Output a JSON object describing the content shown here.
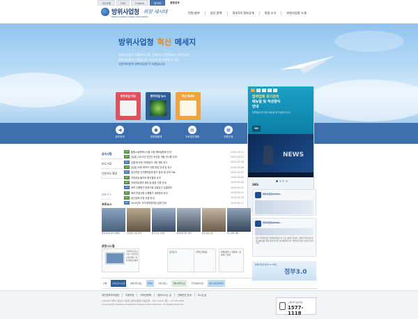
{
  "top_utility": {
    "items": [
      "사이트맵",
      "RSS",
      "English",
      "중국어"
    ],
    "search_label": "통합검색"
  },
  "header": {
    "logo_text": "방위사업청",
    "logo_sub": "Defense Acquisition Program Administration",
    "slogan": "희망 새시대",
    "gnb": [
      "민원·참여",
      "업무·정책",
      "정부3.0 정보공개",
      "알림·소식",
      "방위사업청 소개"
    ]
  },
  "hero": {
    "title_a": "방위사업청",
    "title_b": "혁신",
    "title_c": "메세지",
    "line1": "방위사업청이 투명하고 더욱 강해지고 전문화되어 더욱 높이는",
    "line2": "방위사업청이 되겠습니다. 다시 한 번 신뢰할 수 있는",
    "line3": "국민여러분의 방위사업청 이 되겠습니다.",
    "cards": [
      {
        "label": "방위사업 이슈",
        "color": "#e1515c"
      },
      {
        "label": "방위사업 뉴스",
        "color": "#2d5e9a"
      },
      {
        "label": "혁신 메세지",
        "color": "#f2a43a"
      }
    ]
  },
  "promo": {
    "tabs": [
      "1",
      "2",
      "3",
      "4",
      "5"
    ],
    "title_line1": "협력업체 위기관리",
    "title_line2": "매뉴얼 및 작성양식",
    "title_line3": "안내",
    "text": "협력업체 위기관리 매뉴얼 및 작성양식 안내",
    "go_label": "GO",
    "video_text": "NEWS"
  },
  "quick_menu": [
    {
      "label": "정보공개",
      "icon": "speaker-icon",
      "glyph": "◀"
    },
    {
      "label": "방위청결제",
      "icon": "person-icon",
      "glyph": "●"
    },
    {
      "label": "주요업무계획",
      "icon": "document-icon",
      "glyph": "▤"
    },
    {
      "label": "민원신청",
      "icon": "form-icon",
      "glyph": "▦"
    }
  ],
  "notice": {
    "tabs": [
      "공지사항",
      "보도자료",
      "언론보도해명"
    ],
    "more_label": "더보기 +",
    "rows": [
      {
        "tag": "공지",
        "title": "통합시설정책시스템 사업 예비설명회 안내",
        "date": "2015.05.11"
      },
      {
        "tag": "공지",
        "title": "[입찰] 2015년 연간단 조선분 개발 연시행 안내",
        "date": "2015.05.11"
      },
      {
        "tag": "공지",
        "title": "입찰자(국외) 제재일자 사항 계획 공고",
        "date": "2015.05.06"
      },
      {
        "tag": "공지",
        "title": "[입찰] 국제 계약의 이용 방법 안내 및 공고",
        "date": "2015.05.08"
      },
      {
        "tag": "공지",
        "title": "방산관련 신규협력업체 평가 결과 및 공개 자료",
        "date": "2015.05.07"
      },
      {
        "tag": "공지",
        "title": "국외조달 물자의 평가결과 공개",
        "date": "2015.05.05"
      },
      {
        "tag": "공지",
        "title": "국외조달계약 계획 및 발표 사항 안내",
        "date": "2015.05.05"
      },
      {
        "tag": "공지",
        "title": "계약 수행평가 방위사업 입찰공고 입찰정보",
        "date": "2015.05.01"
      },
      {
        "tag": "공지",
        "title": "계약 변경사항 수행평가 계약정보 공지",
        "date": "2015.05.01"
      },
      {
        "tag": "공지",
        "title": "방산업체 지정 신청 안내",
        "date": "2015.04.28"
      },
      {
        "tag": "공지",
        "title": "2015년도 국가계약법개정 설명 안내",
        "date": "2015.04.27"
      }
    ]
  },
  "photo_news": {
    "title": "포토뉴스",
    "items": [
      "방위사업청 정책 설명회",
      "국방과학 기술 협력",
      "방산 수출 간담회",
      "방위사업 업무 협약",
      "청장 현장 방문",
      "혁신 회의 개최"
    ]
  },
  "related": {
    "title": "관련시스템",
    "cards": [
      {
        "text": "국방전자조달시스템 / 전자입찰 / 발주계획 / 방위사업정보체계"
      },
      {
        "text": "공개조건"
      },
      {
        "text": "정책고객대표"
      },
      {
        "text": "투명/윤리 / 적법성 / 공정성 / 신뢰"
      }
    ]
  },
  "sns": {
    "title": "SNS",
    "account": "방위사업청(DAPA)",
    "post": "최근 국방부장관, 방위사업청장 및 주요 내빈이 참석한 가운데 국내 방산수출 활성화를 위한 협력 방안을 논의하였습니다. 방위사업 관련 소식을 전합니다."
  },
  "gov30": {
    "caption": "방위사업청 정부3.0 서비스",
    "label": "정부3.0"
  },
  "footer_banners": [
    "전체",
    "전자조달시스템",
    "방위사업 정보",
    "국방부",
    "국민신문고",
    "국방과학연구소",
    "국군재정관리단",
    "방산기술지원센터"
  ],
  "footer": {
    "links": [
      "개인정보처리방침",
      "이용약관",
      "저작권정책",
      "찾아오시는 길",
      "전화번호 안내",
      "오시는길"
    ],
    "address": "140-833 서울시 용산구 이촌로 (방위사업청) 대표전화 : 1577-1118, 팩스 : 02-775-7587",
    "copyright": "Copyright(C) Defense Acquisition Program Administration. All Rights Reserved.",
    "call_label": "고객센터 대표번호",
    "call_number": "1577-1118"
  }
}
